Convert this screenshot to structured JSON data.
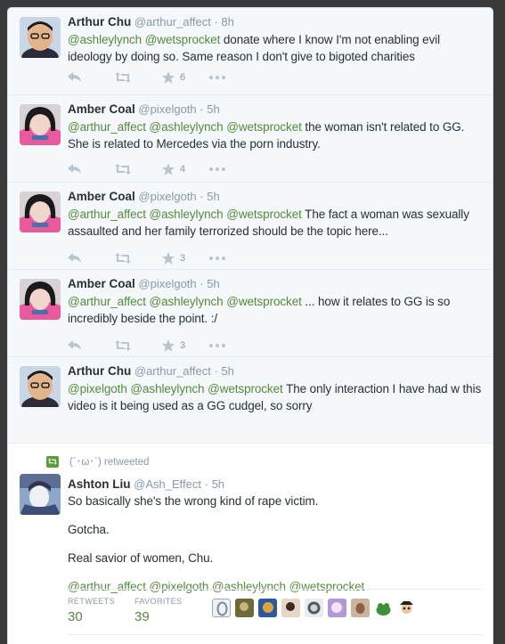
{
  "tweets": [
    {
      "name": "Arthur Chu",
      "handle": "@arthur_affect",
      "time": "8h",
      "mentions": [
        "@ashleylynch",
        "@wetsprocket"
      ],
      "text": " donate where I know I'm not enabling evil ideology by doing so. Same reason I don't give to bigoted charities",
      "favorites": "6"
    },
    {
      "name": "Amber Coal",
      "handle": "@pixelgoth",
      "time": "5h",
      "mentions": [
        "@arthur_affect",
        "@ashleylynch",
        "@wetsprocket"
      ],
      "text": " the woman isn't related to GG. She is related to Mercedes via the porn industry.",
      "favorites": "4"
    },
    {
      "name": "Amber Coal",
      "handle": "@pixelgoth",
      "time": "5h",
      "mentions": [
        "@arthur_affect",
        "@ashleylynch",
        "@wetsprocket"
      ],
      "text": " The fact a woman was sexually assaulted and her family terrorized should be the topic here...",
      "favorites": "3"
    },
    {
      "name": "Amber Coal",
      "handle": "@pixelgoth",
      "time": "5h",
      "mentions": [
        "@arthur_affect",
        "@ashleylynch",
        "@wetsprocket"
      ],
      "text": " ... how it relates to GG is so incredibly beside the point. :/",
      "favorites": "3"
    },
    {
      "name": "Arthur Chu",
      "handle": "@arthur_affect",
      "time": "5h",
      "mentions": [
        "@pixelgoth",
        "@ashleylynch",
        "@wetsprocket"
      ],
      "text": " The only interaction I have had w this video is it being used as a GG cudgel, so sorry",
      "favorites": ""
    }
  ],
  "expanded": {
    "retweeted_by": "(´･ω･`) retweeted",
    "name": "Ashton Liu",
    "handle": "@Ash_Effect",
    "time": "5h",
    "line1": "So basically she's the wrong kind of rape victim.",
    "line2": "Gotcha.",
    "line3": "Real savior of women, Chu.",
    "mentions": [
      "@arthur_affect",
      "@pixelgoth",
      "@ashleylynch",
      "@wetsprocket"
    ],
    "retweets_label": "RETWEETS",
    "retweets": "30",
    "favorites_label": "FAVORITES",
    "favorites": "39",
    "favoriter_avatars": [
      "avatar-1",
      "avatar-2",
      "avatar-3",
      "avatar-4",
      "avatar-5",
      "avatar-6",
      "avatar-7",
      "avatar-8",
      "avatar-9"
    ]
  },
  "colors": {
    "mention": "#55893d",
    "retweet_badge": "#5c9e3a"
  },
  "icons": {
    "reply": "reply-icon",
    "retweet": "retweet-icon",
    "favorite": "star-icon",
    "more": "more-icon"
  }
}
